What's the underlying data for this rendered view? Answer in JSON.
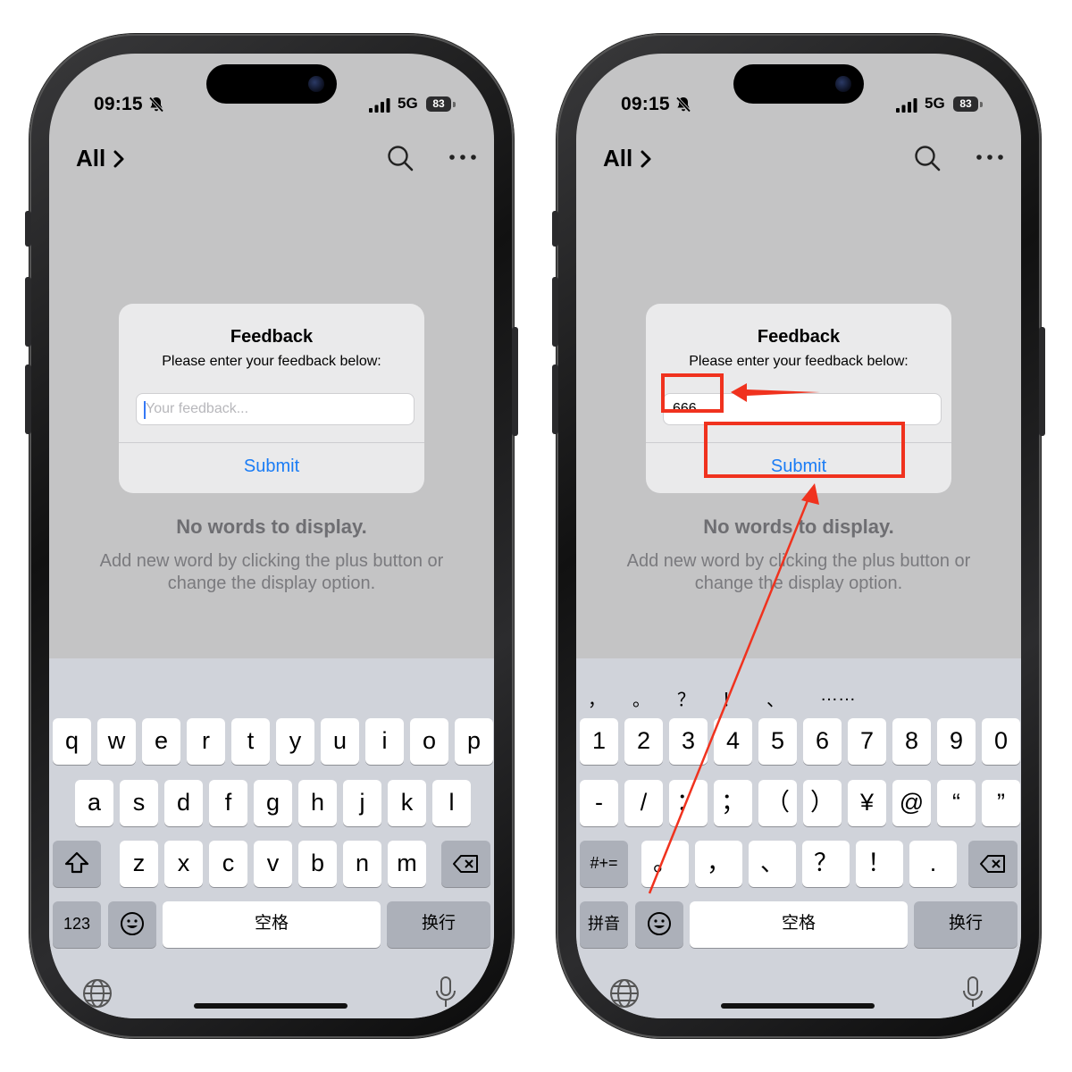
{
  "left_phone": {
    "status": {
      "time": "09:15",
      "network": "5G",
      "battery": "83"
    },
    "nav": {
      "all_label": "All"
    },
    "dialog": {
      "title": "Feedback",
      "message": "Please enter your feedback below:",
      "input_placeholder": "Your feedback...",
      "input_value": "",
      "submit_label": "Submit"
    },
    "empty": {
      "title": "No words to display.",
      "subtitle": "Add new word by clicking the plus button or change the display option."
    },
    "keyboard": {
      "row1": [
        "q",
        "w",
        "e",
        "r",
        "t",
        "y",
        "u",
        "i",
        "o",
        "p"
      ],
      "row2": [
        "a",
        "s",
        "d",
        "f",
        "g",
        "h",
        "j",
        "k",
        "l"
      ],
      "row3": [
        "z",
        "x",
        "c",
        "v",
        "b",
        "n",
        "m"
      ],
      "numbers_key": "123",
      "space_label": "空格",
      "return_label": "换行"
    }
  },
  "right_phone": {
    "status": {
      "time": "09:15",
      "network": "5G",
      "battery": "83"
    },
    "nav": {
      "all_label": "All"
    },
    "dialog": {
      "title": "Feedback",
      "message": "Please enter your feedback below:",
      "input_value": "666",
      "submit_label": "Submit"
    },
    "empty": {
      "title": "No words to display.",
      "subtitle": "Add new word by clicking the plus button or change the display option."
    },
    "keyboard": {
      "candidates": [
        "，",
        "。",
        "？",
        "！",
        "、",
        "……"
      ],
      "row1": [
        "1",
        "2",
        "3",
        "4",
        "5",
        "6",
        "7",
        "8",
        "9",
        "0"
      ],
      "row2": [
        "-",
        "/",
        "：",
        "；",
        "（",
        "）",
        "¥",
        "@",
        "“",
        "”"
      ],
      "row3": [
        "。",
        "，",
        "、",
        "？",
        "！",
        "."
      ],
      "symbols_key": "#+=",
      "pinyin_key": "拼音",
      "space_label": "空格",
      "return_label": "换行"
    }
  },
  "annotations": {
    "highlight_color": "#f0321e"
  }
}
